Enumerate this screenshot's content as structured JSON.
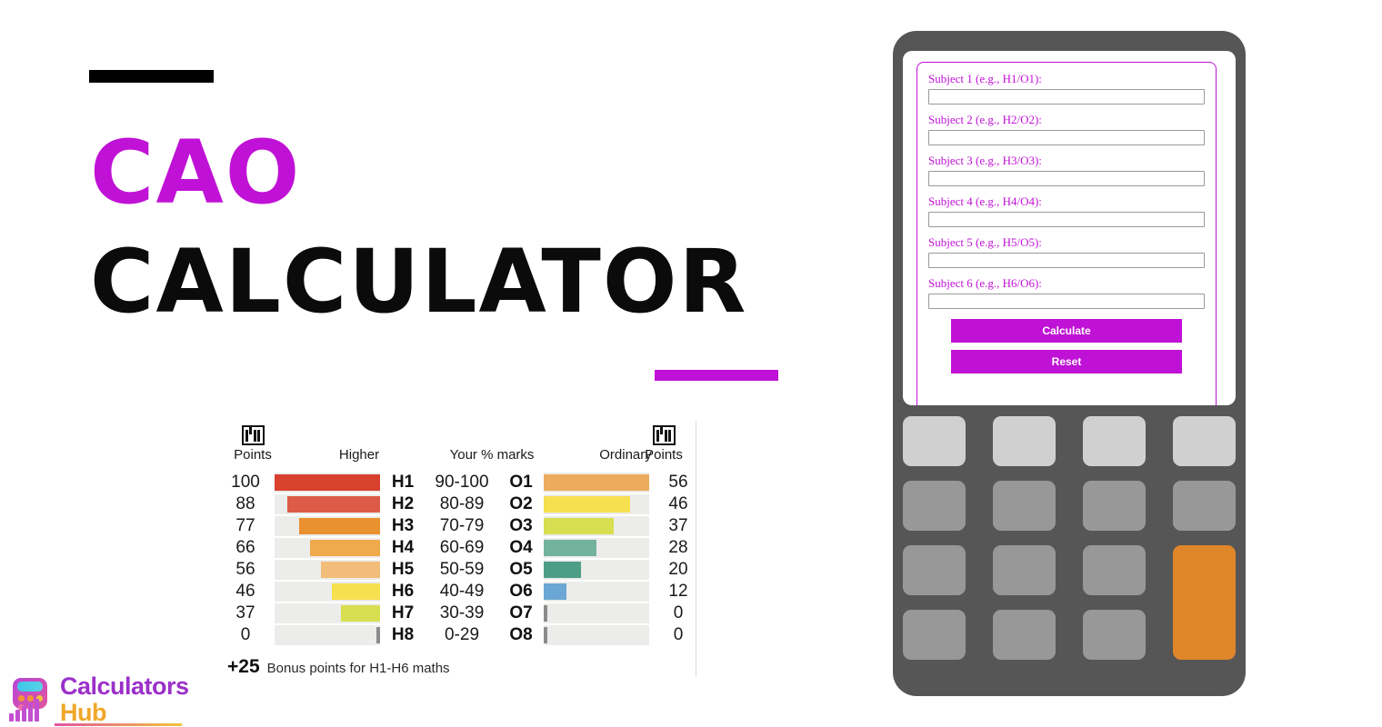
{
  "hero": {
    "line1": "CAO",
    "line2": "CALCULATOR",
    "accent_color": "#c011d6",
    "rule_color": "#000000"
  },
  "logo": {
    "name_top": "Calculators",
    "name_bottom": "Hub",
    "top_color": "#9b30c9",
    "bottom_color": "#f0a72a",
    "icon": "calculator-bars-icon"
  },
  "calculator_form": {
    "fields": [
      {
        "label": "Subject 1 (e.g., H1/O1):",
        "value": "",
        "placeholder": ""
      },
      {
        "label": "Subject 2 (e.g., H2/O2):",
        "value": "",
        "placeholder": ""
      },
      {
        "label": "Subject 3 (e.g., H3/O3):",
        "value": "",
        "placeholder": ""
      },
      {
        "label": "Subject 4 (e.g., H4/O4):",
        "value": "",
        "placeholder": ""
      },
      {
        "label": "Subject 5 (e.g., H5/O5):",
        "value": "",
        "placeholder": ""
      },
      {
        "label": "Subject 6 (e.g., H6/O6):",
        "value": "",
        "placeholder": ""
      }
    ],
    "calculate_label": "Calculate",
    "reset_label": "Reset",
    "button_color": "#c011d6",
    "border_color": "#c011d6"
  },
  "keypad": {
    "body_color": "#565656",
    "key_color": "#989898",
    "key_light_color": "#d0d0d0",
    "accent_key_color": "#e0862a",
    "rows": [
      [
        "",
        "",
        "",
        ""
      ],
      [
        "",
        "",
        "",
        ""
      ],
      [
        "",
        "",
        "",
        ""
      ],
      [
        "",
        "",
        "",
        ""
      ]
    ]
  },
  "chart_data": {
    "type": "bar",
    "title": "",
    "headers": {
      "points_left": "Points",
      "higher": "Higher",
      "marks": "Your % marks",
      "ordinary": "Ordinary",
      "points_right": "Points"
    },
    "categories": [
      "90-100",
      "80-89",
      "70-79",
      "60-69",
      "50-59",
      "40-49",
      "30-39",
      "0-29"
    ],
    "higher_grades": [
      "H1",
      "H2",
      "H3",
      "H4",
      "H5",
      "H6",
      "H7",
      "H8"
    ],
    "ordinary_grades": [
      "O1",
      "O2",
      "O3",
      "O4",
      "O5",
      "O6",
      "O7",
      "O8"
    ],
    "series": [
      {
        "name": "Higher Points",
        "values": [
          100,
          88,
          77,
          66,
          56,
          46,
          37,
          0
        ],
        "colors": [
          "#d9412f",
          "#dd5c47",
          "#e9902f",
          "#f0a94b",
          "#f2bd78",
          "#f6e04f",
          "#d7de4f",
          "#8b8b8b"
        ]
      },
      {
        "name": "Ordinary Points",
        "values": [
          56,
          46,
          37,
          28,
          20,
          12,
          0,
          0
        ],
        "colors": [
          "#edab5e",
          "#f6e04f",
          "#d7de4f",
          "#73b29c",
          "#4d9e86",
          "#6aa7d4",
          "#8b8b8b",
          "#8b8b8b"
        ]
      }
    ],
    "ylim": [
      0,
      100
    ],
    "grid": false,
    "legend": "none",
    "footnote_value": "+25",
    "footnote_text": "Bonus points for H1-H6 maths",
    "badge_icon": "cao-badge-icon"
  }
}
